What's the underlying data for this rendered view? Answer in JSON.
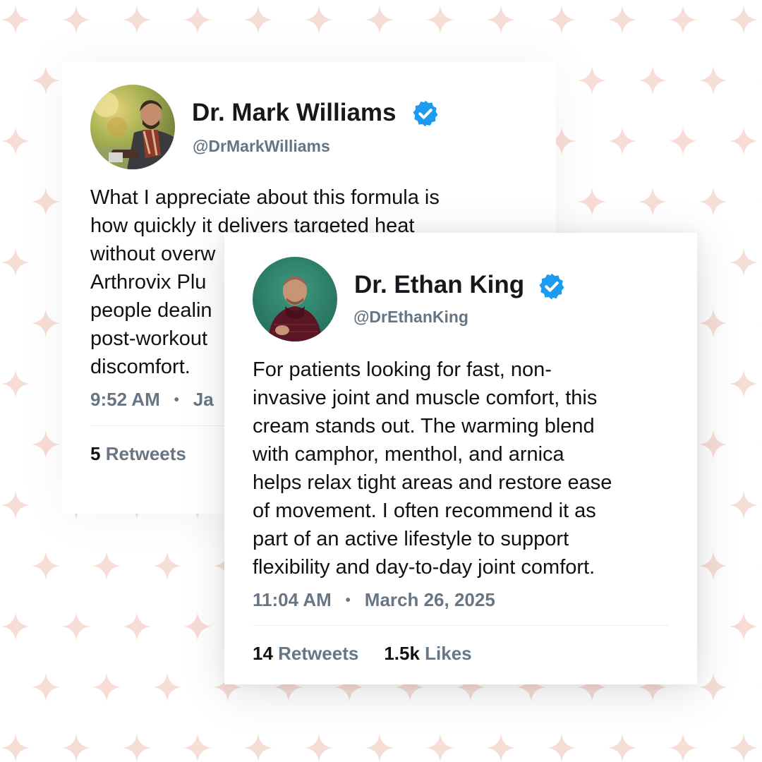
{
  "tweets": [
    {
      "name": "Dr. Mark Williams",
      "handle": "@DrMarkWilliams",
      "body_lines": [
        "What I appreciate about this formula is",
        "how quickly it delivers targeted heat",
        "without overw",
        "Arthrovix Plu",
        "people dealin",
        "post-workout",
        "discomfort."
      ],
      "time": "9:52 AM",
      "date_partial": "Ja",
      "retweets_count": "5",
      "retweets_label": "Retweets"
    },
    {
      "name": "Dr. Ethan King",
      "handle": "@DrEthanKing",
      "body_lines": [
        "For patients looking for fast, non-",
        "invasive joint and muscle comfort, this",
        "cream stands out. The warming blend",
        "with camphor, menthol, and arnica",
        "helps relax tight areas and restore ease",
        "of movement. I often recommend it as",
        "part of an active lifestyle to support",
        "flexibility and day-to-day joint comfort."
      ],
      "time": "11:04 AM",
      "date": "March 26, 2025",
      "retweets_count": "14",
      "retweets_label": "Retweets",
      "likes_count": "1.5k",
      "likes_label": "Likes"
    }
  ],
  "separator": "•",
  "icons": {
    "verified": "verified-badge-icon",
    "background": "sparkle-icon"
  },
  "colors": {
    "verified": "#1d9bf0",
    "sparkle": "#f6ddd6",
    "muted_text": "#687684"
  }
}
